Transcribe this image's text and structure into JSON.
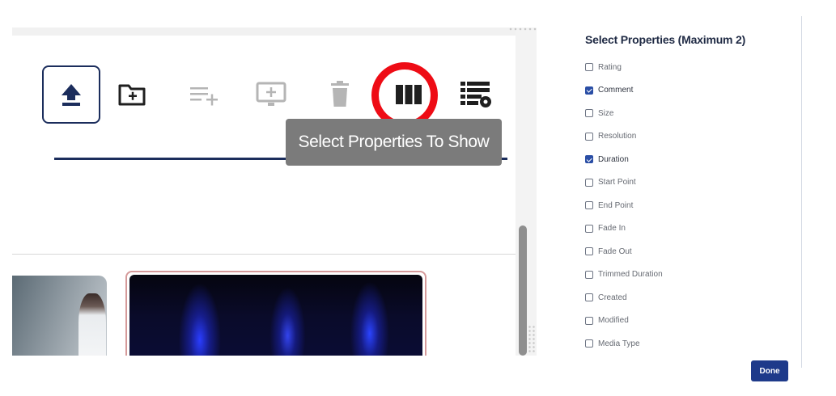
{
  "tooltip": {
    "text": "Select Properties To Show"
  },
  "panel": {
    "title": "Select Properties (Maximum 2)",
    "done_label": "Done",
    "accent_color": "#1e3a8a",
    "properties": [
      {
        "label": "Rating",
        "checked": false
      },
      {
        "label": "Comment",
        "checked": true
      },
      {
        "label": "Size",
        "checked": false
      },
      {
        "label": "Resolution",
        "checked": false
      },
      {
        "label": "Duration",
        "checked": true
      },
      {
        "label": "Start Point",
        "checked": false
      },
      {
        "label": "End Point",
        "checked": false
      },
      {
        "label": "Fade In",
        "checked": false
      },
      {
        "label": "Fade Out",
        "checked": false
      },
      {
        "label": "Trimmed Duration",
        "checked": false
      },
      {
        "label": "Created",
        "checked": false
      },
      {
        "label": "Modified",
        "checked": false
      },
      {
        "label": "Media Type",
        "checked": false
      }
    ]
  },
  "toolbar": {
    "icons": [
      "upload-icon",
      "add-folder-icon",
      "add-to-playlist-icon",
      "add-to-screen-icon",
      "trash-icon",
      "columns-icon",
      "list-settings-icon"
    ],
    "highlight_color": "#ee0c15"
  }
}
